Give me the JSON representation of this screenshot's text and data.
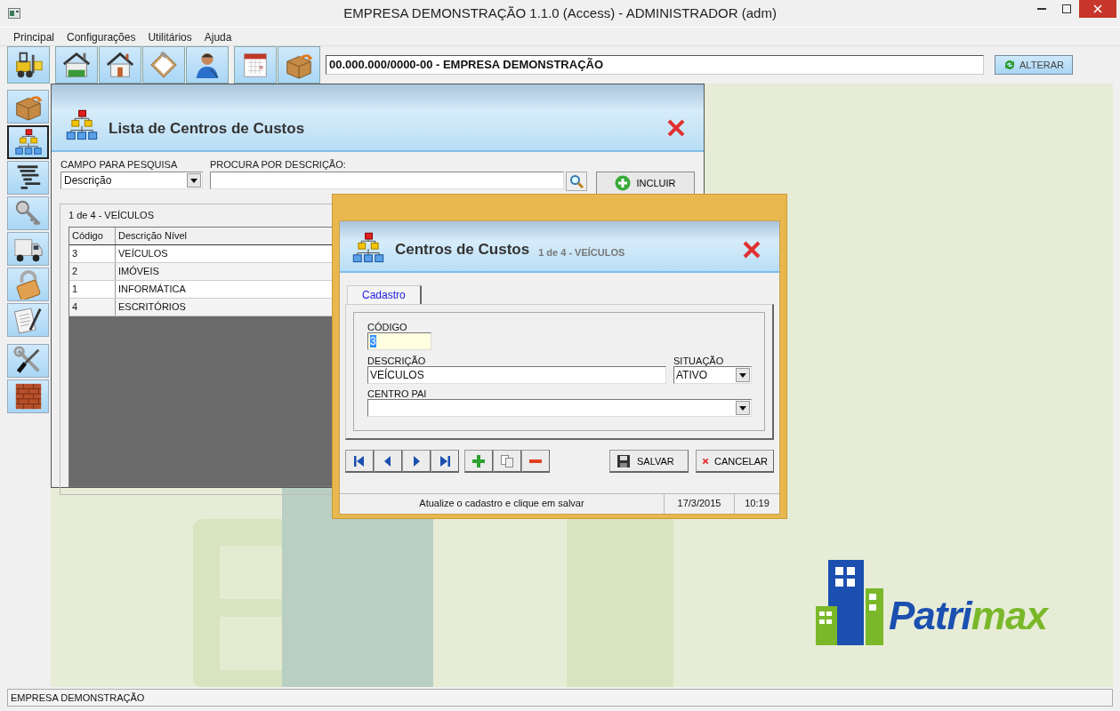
{
  "window": {
    "title": "EMPRESA DEMONSTRAÇÃO 1.1.0 (Access) - ADMINISTRADOR (adm)"
  },
  "menu": [
    "Principal",
    "Configurações",
    "Utilitários",
    "Ajuda"
  ],
  "toolbar": {
    "groups": [
      [
        {
          "kind": "forklift"
        }
      ],
      [
        {
          "kind": "warehouse"
        },
        {
          "kind": "house"
        },
        {
          "kind": "clipboard"
        },
        {
          "kind": "person"
        }
      ],
      [
        {
          "kind": "calendar"
        },
        {
          "kind": "box"
        }
      ]
    ],
    "company": "00.000.000/0000-00 - EMPRESA DEMONSTRAÇÃO",
    "change_button": "ALTERAR"
  },
  "sidebar": {
    "groups": [
      [
        {
          "kind": "box",
          "selected": false
        },
        {
          "kind": "orgchart",
          "selected": true
        },
        {
          "kind": "steps",
          "selected": false
        },
        {
          "kind": "key",
          "selected": false
        },
        {
          "kind": "truck",
          "selected": false
        },
        {
          "kind": "padlock",
          "selected": false
        },
        {
          "kind": "document",
          "selected": false
        }
      ],
      [
        {
          "kind": "tools",
          "selected": false
        },
        {
          "kind": "bricks",
          "selected": false
        }
      ]
    ]
  },
  "list_window": {
    "title": "Lista de Centros de Custos",
    "field_label": "CAMPO PARA PESQUISA",
    "field_value": "Descrição",
    "search_label": "PROCURA POR DESCRIÇÃO:",
    "add_button": "INCLUIR",
    "record_info": "1 de 4 - VEÍCULOS",
    "table": {
      "columns": [
        "Código",
        "Descrição Nível"
      ],
      "rows": [
        [
          "3",
          "VEÍCULOS"
        ],
        [
          "2",
          "IMÓVEIS"
        ],
        [
          "1",
          "INFORMÁTICA"
        ],
        [
          "4",
          "ESCRITÓRIOS"
        ]
      ]
    }
  },
  "dialog": {
    "title": "Centros de Custos",
    "subtitle": "1 de 4 - VEÍCULOS",
    "tabs": [
      {
        "label": "Cadastro",
        "selected": true
      }
    ],
    "code": {
      "label": "CÓDIGO",
      "value": "3",
      "text_selected": true
    },
    "description": {
      "label": "DESCRIÇÃO",
      "value": "VEÍCULOS"
    },
    "situation": {
      "label": "SITUAÇÃO",
      "value": "ATIVO"
    },
    "parent": {
      "label": "CENTRO PAI"
    },
    "nav_groups": [
      [
        {
          "kind": "first"
        },
        {
          "kind": "prev"
        },
        {
          "kind": "next"
        },
        {
          "kind": "last"
        }
      ],
      [
        {
          "kind": "add"
        },
        {
          "kind": "copy"
        },
        {
          "kind": "remove"
        }
      ]
    ],
    "actions": [
      {
        "kind": "save",
        "label": "SALVAR"
      },
      {
        "kind": "cancel",
        "label": "CANCELAR"
      }
    ],
    "status": {
      "message": "Atualize o cadastro e clique em salvar",
      "date": "17/3/2015",
      "time": "10:19"
    }
  },
  "logo": {
    "main": "Patri",
    "accent": "max"
  },
  "status_bar": "EMPRESA DEMONSTRAÇÃO"
}
